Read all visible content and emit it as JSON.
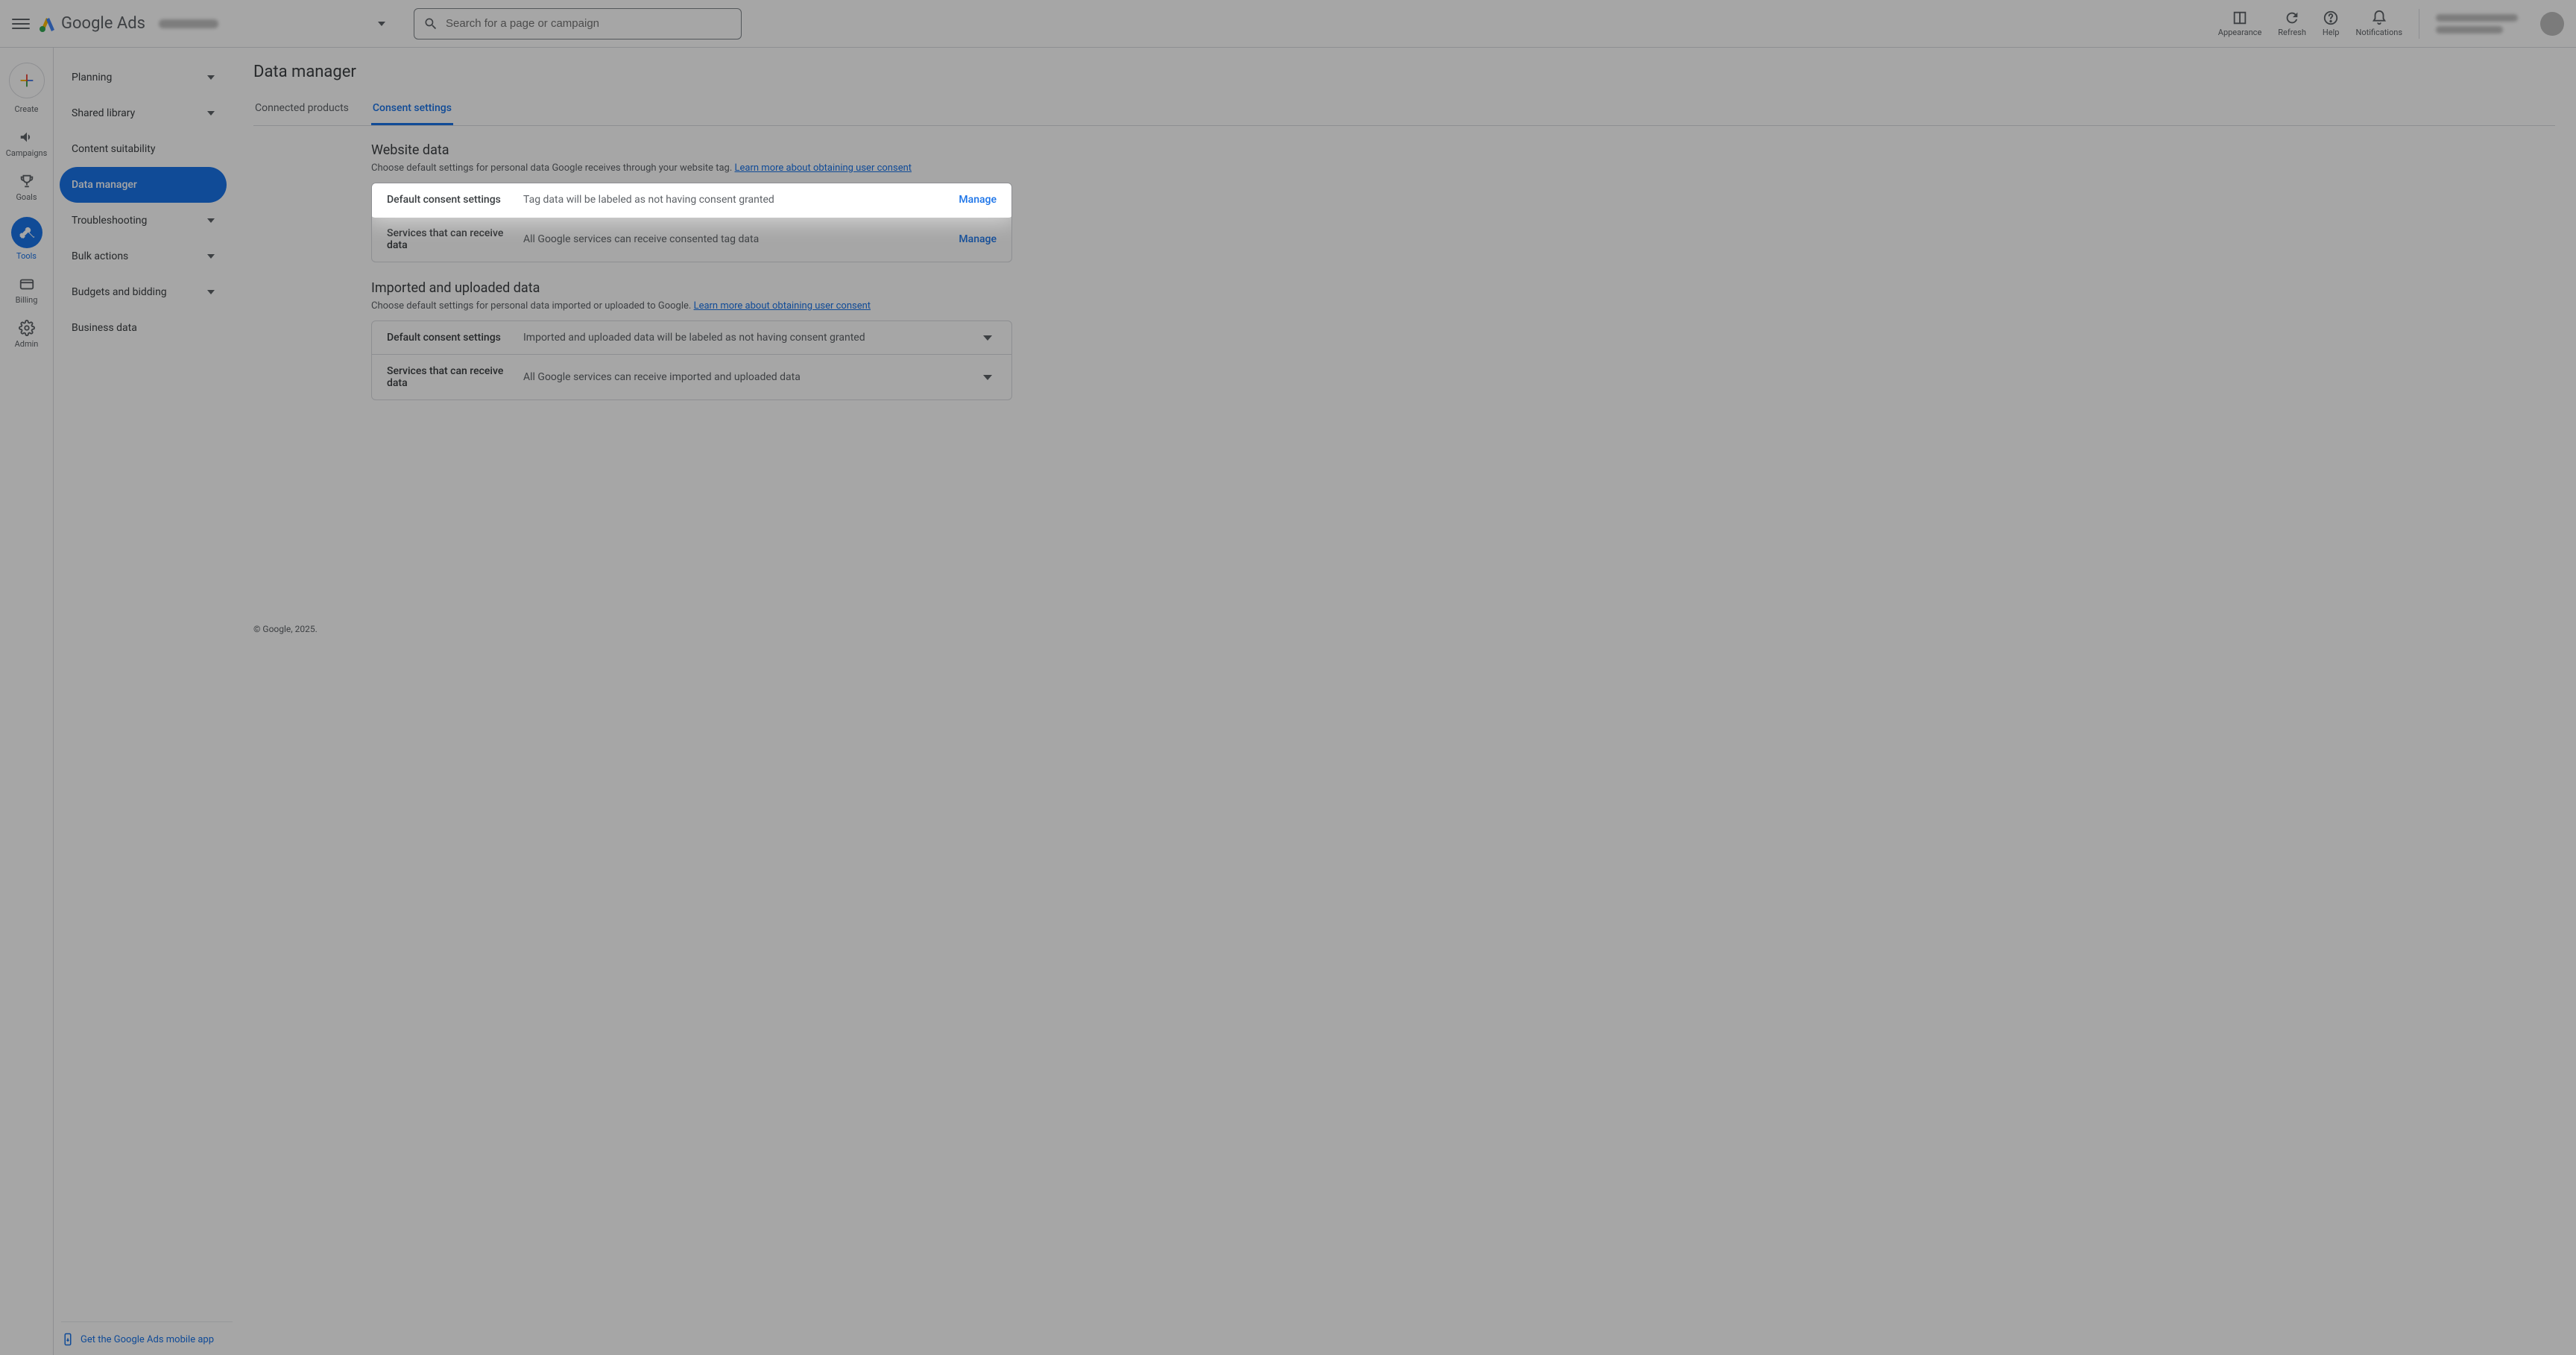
{
  "header": {
    "product": "Google",
    "product_suffix": "Ads",
    "search_placeholder": "Search for a page or campaign",
    "actions": {
      "appearance": "Appearance",
      "refresh": "Refresh",
      "help": "Help",
      "notifications": "Notifications"
    }
  },
  "rail": {
    "create": "Create",
    "items": [
      {
        "label": "Campaigns"
      },
      {
        "label": "Goals"
      },
      {
        "label": "Tools"
      },
      {
        "label": "Billing"
      },
      {
        "label": "Admin"
      }
    ]
  },
  "sidenav": {
    "items": [
      {
        "label": "Planning",
        "expandable": true
      },
      {
        "label": "Shared library",
        "expandable": true
      },
      {
        "label": "Content suitability",
        "expandable": false
      },
      {
        "label": "Data manager",
        "expandable": false,
        "selected": true
      },
      {
        "label": "Troubleshooting",
        "expandable": true
      },
      {
        "label": "Bulk actions",
        "expandable": true
      },
      {
        "label": "Budgets and bidding",
        "expandable": true
      },
      {
        "label": "Business data",
        "expandable": false
      }
    ],
    "footer": "Get the Google Ads mobile app"
  },
  "main": {
    "title": "Data manager",
    "tabs": [
      {
        "label": "Connected products",
        "active": false
      },
      {
        "label": "Consent settings",
        "active": true
      }
    ],
    "sections": [
      {
        "title": "Website data",
        "subtitle": "Choose default settings for personal data Google receives through your website tag.",
        "link": "Learn more about obtaining user consent",
        "rows": [
          {
            "label": "Default consent settings",
            "desc": "Tag data will be labeled as not having consent granted",
            "action": "Manage",
            "highlighted": true
          },
          {
            "label": "Services that can receive data",
            "desc": "All Google services can receive consented tag data",
            "action": "Manage"
          }
        ]
      },
      {
        "title": "Imported and uploaded data",
        "subtitle": "Choose default settings for personal data imported or uploaded to Google.",
        "link": "Learn more about obtaining user consent",
        "rows": [
          {
            "label": "Default consent settings",
            "desc": "Imported and uploaded data will be labeled as not having consent granted",
            "expand": true
          },
          {
            "label": "Services that can receive data",
            "desc": "All Google services can receive imported and uploaded data",
            "expand": true
          }
        ]
      }
    ],
    "footer": "© Google, 2025."
  }
}
